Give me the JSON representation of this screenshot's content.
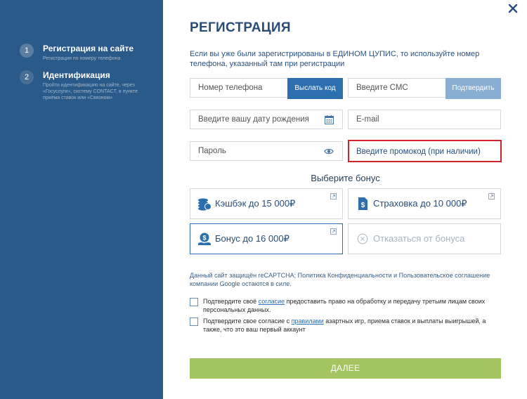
{
  "sidebar": {
    "steps": [
      {
        "number": "1",
        "title": "Регистрация на сайте",
        "desc": "Регистрация по номеру телефона"
      },
      {
        "number": "2",
        "title": "Идентификация",
        "desc": "Пройти идентификацию на сайте, через «Госуслуги», систему CONTACT, в пункте приёма ставок или «Связном»"
      }
    ]
  },
  "title": "РЕГИСТРАЦИЯ",
  "intro": "Если вы уже были зарегистрированы в ЕДИНОМ ЦУПИС, то используйте номер телефона, указанный там при регистрации",
  "form": {
    "phone_placeholder": "Номер телефона",
    "send_code_label": "Выслать код",
    "sms_placeholder": "Введите СМС",
    "confirm_label": "Подтвердить",
    "birthdate_placeholder": "Введите вашу дату рождения",
    "email_placeholder": "E-mail",
    "password_placeholder": "Пароль",
    "promo_placeholder": "Введите промокод (при наличии)"
  },
  "bonus": {
    "title": "Выберите бонус",
    "options": [
      {
        "label": "Кэшбэк до 15 000₽",
        "icon": "coins-icon"
      },
      {
        "label": "Страховка до 10 000₽",
        "icon": "insurance-document-icon"
      },
      {
        "label": "Бонус до 16 000₽",
        "icon": "bonus-hand-coin-icon",
        "selected": true
      },
      {
        "label": "Отказаться от бонуса",
        "icon": "decline-icon",
        "disabled": true
      }
    ]
  },
  "recaptcha_text": "Данный сайт защищён reCAPTCHA; Политика Конфиденциальности и Пользовательское соглашение компании Google остаются в силе.",
  "consents": [
    {
      "before": "Подтвердите своё ",
      "link": "согласие",
      "after": " предоставить право на обработку и передачу третьим лицам своих персональных данных."
    },
    {
      "before": "Подтвердите свое согласие с ",
      "link": "правилами",
      "after": " азартных игр, приема ставок и выплаты выигрышей, а также, что это ваш первый аккаунт"
    }
  ],
  "submit_label": "ДАЛЕЕ",
  "colors": {
    "sidebar": "#2a5a89",
    "accent": "#2c6fae",
    "submit": "#a4c462",
    "promo_border": "#d0232b"
  }
}
